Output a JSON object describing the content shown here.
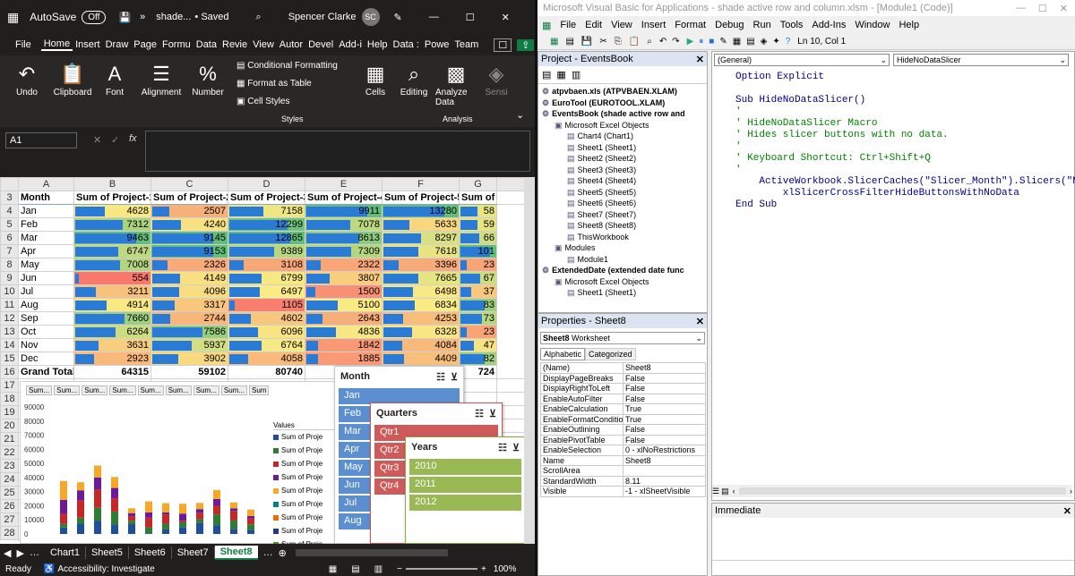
{
  "excel": {
    "title": {
      "autosave": "AutoSave",
      "toggle": "Off",
      "file": "shade...",
      "saved": "• Saved",
      "user": "Spencer Clarke",
      "initials": "SC"
    },
    "tabs": [
      "File",
      "Home",
      "Insert",
      "Draw",
      "Page",
      "Formu",
      "Data",
      "Revie",
      "View",
      "Autor",
      "Devel",
      "Add-i",
      "Help",
      "Data :",
      "Powe",
      "Team"
    ],
    "ribbon": {
      "undo": "Undo",
      "clipboard": "Clipboard",
      "font": "Font",
      "alignment": "Alignment",
      "number": "Number",
      "cond_fmt": "Conditional Formatting",
      "fmt_table": "Format as Table",
      "cell_styles": "Cell Styles",
      "styles": "Styles",
      "cells": "Cells",
      "editing": "Editing",
      "analyze": "Analyze Data",
      "analysis": "Analysis",
      "sens": "Sensi"
    },
    "namebox": "A1",
    "fx": "fx",
    "columns": [
      "A",
      "B",
      "C",
      "D",
      "E",
      "F",
      "G"
    ],
    "headers": [
      "Month",
      "Sum of Project-1",
      "Sum of Project-2",
      "Sum of Project-3",
      "Sum of Project-4",
      "Sum of Project-5",
      "Sum of Project-"
    ],
    "rows": [
      [
        "Jan",
        "4628",
        "2507",
        "7158",
        "9911",
        "13280",
        "58"
      ],
      [
        "Feb",
        "7312",
        "4240",
        "12299",
        "7078",
        "5633",
        "59"
      ],
      [
        "Mar",
        "9463",
        "9145",
        "12865",
        "8613",
        "8297",
        "66"
      ],
      [
        "Apr",
        "6747",
        "9153",
        "9389",
        "7309",
        "7618",
        "101"
      ],
      [
        "May",
        "7008",
        "2326",
        "3108",
        "2322",
        "3396",
        "23"
      ],
      [
        "Jun",
        "554",
        "4149",
        "6799",
        "3807",
        "7665",
        "67"
      ],
      [
        "Jul",
        "3211",
        "4096",
        "6497",
        "1500",
        "6498",
        "37"
      ],
      [
        "Aug",
        "4914",
        "3317",
        "1105",
        "5100",
        "6834",
        "83"
      ],
      [
        "Sep",
        "7660",
        "2744",
        "4602",
        "2643",
        "4253",
        "73"
      ],
      [
        "Oct",
        "6264",
        "7586",
        "6096",
        "4836",
        "6328",
        "23"
      ],
      [
        "Nov",
        "3631",
        "5937",
        "6764",
        "1842",
        "4084",
        "47"
      ],
      [
        "Dec",
        "2923",
        "3902",
        "4058",
        "1885",
        "4409",
        "82"
      ]
    ],
    "grand": [
      "Grand Total",
      "64315",
      "59102",
      "80740",
      "",
      "",
      "724"
    ],
    "rownums": [
      "3",
      "4",
      "5",
      "6",
      "7",
      "8",
      "9",
      "10",
      "11",
      "12",
      "13",
      "14",
      "15",
      "16",
      "17",
      "18",
      "19",
      "20",
      "21",
      "22",
      "23",
      "24",
      "25",
      "26",
      "27",
      "28"
    ],
    "chart_buttons": [
      "Sum...",
      "Sum...",
      "Sum...",
      "Sum...",
      "Sum...",
      "Sum...",
      "Sum...",
      "Sum...",
      "Sum"
    ],
    "chart_yticks": [
      "90000",
      "80000",
      "70000",
      "60000",
      "50000",
      "40000",
      "30000",
      "20000",
      "10000",
      "0"
    ],
    "legend_title": "Values",
    "legend_items": [
      "Sum of Proje",
      "Sum of Proje",
      "Sum of Proje",
      "Sum of Proje",
      "Sum of Proje",
      "Sum of Proje",
      "Sum of Proje",
      "Sum of Proje",
      "Sum of Proje"
    ],
    "slicer_month": {
      "title": "Month",
      "items": [
        "Jan",
        "Feb",
        "Mar",
        "Apr",
        "May",
        "Jun",
        "Jul",
        "Aug"
      ]
    },
    "slicer_quarters": {
      "title": "Quarters",
      "items": [
        "Qtr1",
        "Qtr2",
        "Qtr3",
        "Qtr4"
      ]
    },
    "slicer_years": {
      "title": "Years",
      "items": [
        "2010",
        "2011",
        "2012"
      ]
    },
    "sheets": [
      "Chart1",
      "Sheet5",
      "Sheet6",
      "Sheet7",
      "Sheet8"
    ],
    "status": {
      "ready": "Ready",
      "access": "Accessibility: Investigate",
      "zoom": "100%"
    }
  },
  "vbe": {
    "title": "Microsoft Visual Basic for Applications - shade active row and column.xlsm - [Module1 (Code)]",
    "menu": [
      "File",
      "Edit",
      "View",
      "Insert",
      "Format",
      "Debug",
      "Run",
      "Tools",
      "Add-Ins",
      "Window",
      "Help"
    ],
    "position": "Ln 10, Col 1",
    "project_title": "Project - EventsBook",
    "tree": [
      "atpvbaen.xls (ATPVBAEN.XLAM)",
      "EuroTool (EUROTOOL.XLAM)",
      "EventsBook (shade active row and",
      "Microsoft Excel Objects",
      "Chart4 (Chart1)",
      "Sheet1 (Sheet1)",
      "Sheet2 (Sheet2)",
      "Sheet3 (Sheet3)",
      "Sheet4 (Sheet4)",
      "Sheet5 (Sheet5)",
      "Sheet6 (Sheet6)",
      "Sheet7 (Sheet7)",
      "Sheet8 (Sheet8)",
      "ThisWorkbook",
      "Modules",
      "Module1",
      "ExtendedDate (extended date func",
      "Microsoft Excel Objects",
      "Sheet1 (Sheet1)"
    ],
    "props_title": "Properties - Sheet8",
    "props_object": "Sheet8",
    "props_type": "Worksheet",
    "props_tabs": [
      "Alphabetic",
      "Categorized"
    ],
    "props": [
      [
        "(Name)",
        "Sheet8"
      ],
      [
        "DisplayPageBreaks",
        "False"
      ],
      [
        "DisplayRightToLeft",
        "False"
      ],
      [
        "EnableAutoFilter",
        "False"
      ],
      [
        "EnableCalculation",
        "True"
      ],
      [
        "EnableFormatConditionsC",
        "True"
      ],
      [
        "EnableOutlining",
        "False"
      ],
      [
        "EnablePivotTable",
        "False"
      ],
      [
        "EnableSelection",
        "0 - xlNoRestrictions"
      ],
      [
        "Name",
        "Sheet8"
      ],
      [
        "ScrollArea",
        ""
      ],
      [
        "StandardWidth",
        "8.11"
      ],
      [
        "Visible",
        "-1 - xlSheetVisible"
      ]
    ],
    "combo_left": "(General)",
    "combo_right": "HideNoDataSlicer",
    "code": [
      "Option Explicit",
      "",
      "Sub HideNoDataSlicer()",
      "'",
      "' HideNoDataSlicer Macro",
      "' Hides slicer buttons with no data.",
      "'",
      "' Keyboard Shortcut: Ctrl+Shift+Q",
      "'",
      "    ActiveWorkbook.SlicerCaches(\"Slicer_Month\").Slicers(\"Mo",
      "        xlSlicerCrossFilterHideButtonsWithNoData",
      "End Sub"
    ],
    "immediate": "Immediate"
  }
}
